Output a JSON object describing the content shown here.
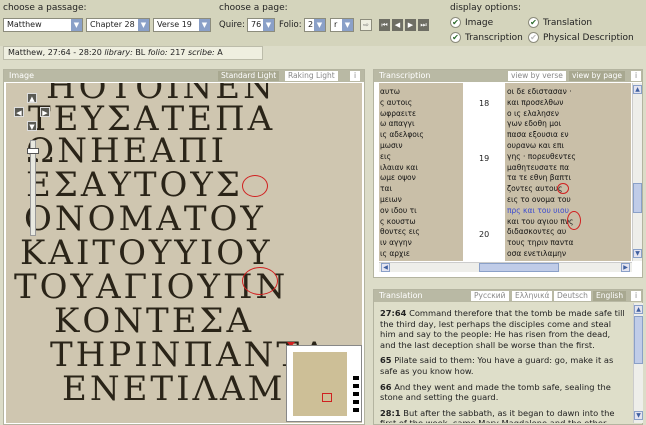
{
  "passage": {
    "label": "choose a passage:",
    "book": "Matthew",
    "chapter": "Chapter 28",
    "verse": "Verse 19"
  },
  "page": {
    "label": "choose a page:",
    "quire_label": "Quire:",
    "quire": "76",
    "folio_label": "Folio:",
    "folio": "2",
    "side": "r",
    "go_label": "⇨"
  },
  "display": {
    "label": "display options:",
    "image": "Image",
    "transcription": "Transcription",
    "translation": "Translation",
    "physical": "Physical Description"
  },
  "info": {
    "ref": "Matthew, 27:64 - 28:20",
    "library_label": "library:",
    "library": "BL",
    "folio_label": "folio:",
    "folio": "217",
    "scribe_label": "scribe:",
    "scribe": "A"
  },
  "image_panel": {
    "title": "Image",
    "tab_standard": "Standard Light",
    "tab_raking": "Raking Light",
    "info": "i",
    "lines": [
      "ΗΟΤΟΙΝΕΝ",
      "ΤΕΥΣΑΤΕΠΑ",
      "ΩΝΗΕΑΠΙ",
      "ΕΣΑΥΤΟΥΣ",
      "ΟΝΟΜΑΤΟΥ",
      "ΚΑΙΤΟΥΥΙΟΥ",
      "ΤΟΥΑΓΙΟΥΠΝ",
      "ΚΟΝΤΕΣΑ",
      "ΤΗΡΙΝΠΑΝΤΑ",
      "ΕΝΕΤΙΛΑΜΗΝ"
    ]
  },
  "transcription_panel": {
    "title": "Transcription",
    "tab_verse": "view by verse",
    "tab_page": "view by page",
    "info": "i",
    "left_lines": [
      "αυτω",
      "ς αυτοις",
      "ωφραειτε",
      "ω απαγγι",
      "ις αδελφοις",
      "μωσιν",
      "εις",
      "ιλαιαν και",
      "ωμε οψον",
      "ται",
      "μειων",
      "ον ιδου τι",
      "ς κουστω",
      "θοντες εις",
      "ιν αγγην",
      "ις αρχιε",
      "παντα τα"
    ],
    "right_lines": [
      "οι δε εδιστασαν ·",
      "και προσελθων",
      "ο ις ελαλησεν",
      "γων εδοθη μοι",
      "πασα εξουσια εν",
      "ουρανω και επι",
      "γης · πορευθεντες",
      "μαθητευσατε πα",
      "τα τε εθνη βαπτι",
      "ζοντες αυτους",
      "εις το ονομα του",
      "πρς και του υιου",
      "και του αγιου πνς",
      "διδασκοντες αυ",
      "τους τηριν παντα",
      "οσα ενετιλαμην"
    ],
    "blue_right": [
      "πρς"
    ],
    "verse_18": "18",
    "verse_19": "19",
    "verse_20": "20"
  },
  "translation_panel": {
    "title": "Translation",
    "tab_ru": "Русский",
    "tab_el": "Ελληνικά",
    "tab_de": "Deutsch",
    "tab_en": "English",
    "info": "i",
    "paras": [
      {
        "num": "27:64",
        "text": "Command therefore that the tomb be made safe till the third day, lest perhaps the disciples come and steal him and say to the people: He has risen from the dead, and the last deception shall be worse than the first."
      },
      {
        "num": "65",
        "text": "Pilate said to them: You have a guard: go, make it as safe as you know how."
      },
      {
        "num": "66",
        "text": "And they went and made the tomb safe, sealing the stone and setting the guard."
      },
      {
        "num": "28:1",
        "text": "But after the sabbath, as it began to dawn into the first of the week, came Mary Magdalene and the other Mary"
      }
    ]
  },
  "colors": {
    "header_gray": "#b9b9a4",
    "active_tab": "#a8a890",
    "annotation_red": "#d02020",
    "translation_bg": "#dedec9"
  }
}
